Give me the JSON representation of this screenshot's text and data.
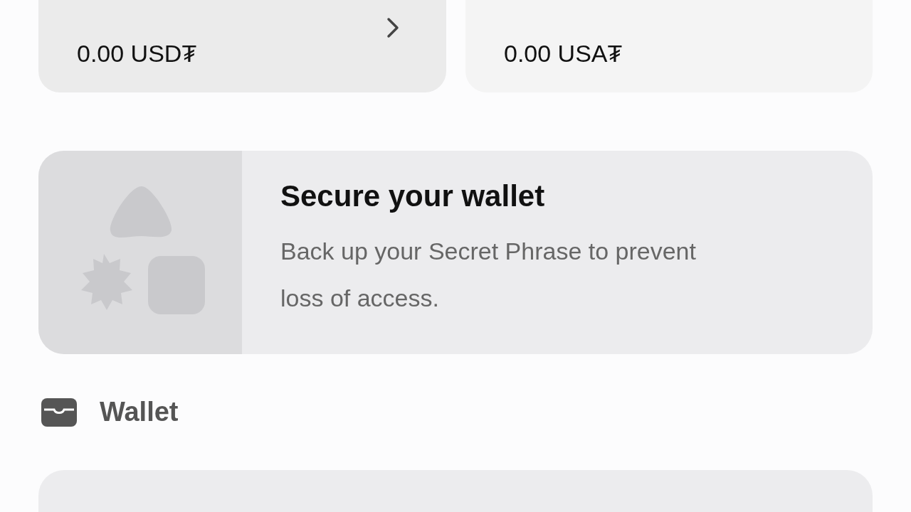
{
  "balances": [
    {
      "amount": "0.00 USD₮",
      "chevron": true
    },
    {
      "amount": "0.00 USA₮",
      "chevron": false
    }
  ],
  "backup_card": {
    "title": "Secure your wallet",
    "body": "Back up your Secret Phrase to prevent loss of access."
  },
  "section": {
    "title": "Wallet"
  }
}
